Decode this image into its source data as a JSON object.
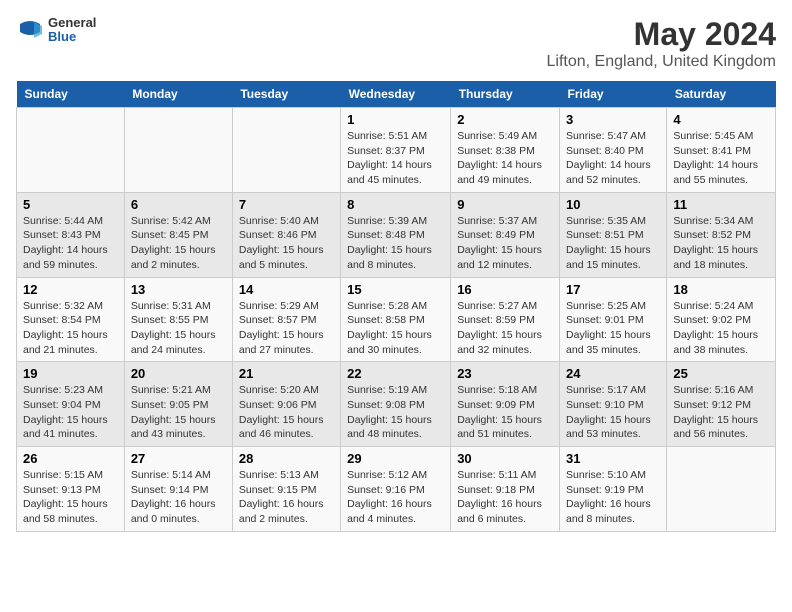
{
  "header": {
    "logo_general": "General",
    "logo_blue": "Blue",
    "title": "May 2024",
    "subtitle": "Lifton, England, United Kingdom"
  },
  "days_of_week": [
    "Sunday",
    "Monday",
    "Tuesday",
    "Wednesday",
    "Thursday",
    "Friday",
    "Saturday"
  ],
  "weeks": [
    [
      {
        "day": "",
        "info": ""
      },
      {
        "day": "",
        "info": ""
      },
      {
        "day": "",
        "info": ""
      },
      {
        "day": "1",
        "info": "Sunrise: 5:51 AM\nSunset: 8:37 PM\nDaylight: 14 hours\nand 45 minutes."
      },
      {
        "day": "2",
        "info": "Sunrise: 5:49 AM\nSunset: 8:38 PM\nDaylight: 14 hours\nand 49 minutes."
      },
      {
        "day": "3",
        "info": "Sunrise: 5:47 AM\nSunset: 8:40 PM\nDaylight: 14 hours\nand 52 minutes."
      },
      {
        "day": "4",
        "info": "Sunrise: 5:45 AM\nSunset: 8:41 PM\nDaylight: 14 hours\nand 55 minutes."
      }
    ],
    [
      {
        "day": "5",
        "info": "Sunrise: 5:44 AM\nSunset: 8:43 PM\nDaylight: 14 hours\nand 59 minutes."
      },
      {
        "day": "6",
        "info": "Sunrise: 5:42 AM\nSunset: 8:45 PM\nDaylight: 15 hours\nand 2 minutes."
      },
      {
        "day": "7",
        "info": "Sunrise: 5:40 AM\nSunset: 8:46 PM\nDaylight: 15 hours\nand 5 minutes."
      },
      {
        "day": "8",
        "info": "Sunrise: 5:39 AM\nSunset: 8:48 PM\nDaylight: 15 hours\nand 8 minutes."
      },
      {
        "day": "9",
        "info": "Sunrise: 5:37 AM\nSunset: 8:49 PM\nDaylight: 15 hours\nand 12 minutes."
      },
      {
        "day": "10",
        "info": "Sunrise: 5:35 AM\nSunset: 8:51 PM\nDaylight: 15 hours\nand 15 minutes."
      },
      {
        "day": "11",
        "info": "Sunrise: 5:34 AM\nSunset: 8:52 PM\nDaylight: 15 hours\nand 18 minutes."
      }
    ],
    [
      {
        "day": "12",
        "info": "Sunrise: 5:32 AM\nSunset: 8:54 PM\nDaylight: 15 hours\nand 21 minutes."
      },
      {
        "day": "13",
        "info": "Sunrise: 5:31 AM\nSunset: 8:55 PM\nDaylight: 15 hours\nand 24 minutes."
      },
      {
        "day": "14",
        "info": "Sunrise: 5:29 AM\nSunset: 8:57 PM\nDaylight: 15 hours\nand 27 minutes."
      },
      {
        "day": "15",
        "info": "Sunrise: 5:28 AM\nSunset: 8:58 PM\nDaylight: 15 hours\nand 30 minutes."
      },
      {
        "day": "16",
        "info": "Sunrise: 5:27 AM\nSunset: 8:59 PM\nDaylight: 15 hours\nand 32 minutes."
      },
      {
        "day": "17",
        "info": "Sunrise: 5:25 AM\nSunset: 9:01 PM\nDaylight: 15 hours\nand 35 minutes."
      },
      {
        "day": "18",
        "info": "Sunrise: 5:24 AM\nSunset: 9:02 PM\nDaylight: 15 hours\nand 38 minutes."
      }
    ],
    [
      {
        "day": "19",
        "info": "Sunrise: 5:23 AM\nSunset: 9:04 PM\nDaylight: 15 hours\nand 41 minutes."
      },
      {
        "day": "20",
        "info": "Sunrise: 5:21 AM\nSunset: 9:05 PM\nDaylight: 15 hours\nand 43 minutes."
      },
      {
        "day": "21",
        "info": "Sunrise: 5:20 AM\nSunset: 9:06 PM\nDaylight: 15 hours\nand 46 minutes."
      },
      {
        "day": "22",
        "info": "Sunrise: 5:19 AM\nSunset: 9:08 PM\nDaylight: 15 hours\nand 48 minutes."
      },
      {
        "day": "23",
        "info": "Sunrise: 5:18 AM\nSunset: 9:09 PM\nDaylight: 15 hours\nand 51 minutes."
      },
      {
        "day": "24",
        "info": "Sunrise: 5:17 AM\nSunset: 9:10 PM\nDaylight: 15 hours\nand 53 minutes."
      },
      {
        "day": "25",
        "info": "Sunrise: 5:16 AM\nSunset: 9:12 PM\nDaylight: 15 hours\nand 56 minutes."
      }
    ],
    [
      {
        "day": "26",
        "info": "Sunrise: 5:15 AM\nSunset: 9:13 PM\nDaylight: 15 hours\nand 58 minutes."
      },
      {
        "day": "27",
        "info": "Sunrise: 5:14 AM\nSunset: 9:14 PM\nDaylight: 16 hours\nand 0 minutes."
      },
      {
        "day": "28",
        "info": "Sunrise: 5:13 AM\nSunset: 9:15 PM\nDaylight: 16 hours\nand 2 minutes."
      },
      {
        "day": "29",
        "info": "Sunrise: 5:12 AM\nSunset: 9:16 PM\nDaylight: 16 hours\nand 4 minutes."
      },
      {
        "day": "30",
        "info": "Sunrise: 5:11 AM\nSunset: 9:18 PM\nDaylight: 16 hours\nand 6 minutes."
      },
      {
        "day": "31",
        "info": "Sunrise: 5:10 AM\nSunset: 9:19 PM\nDaylight: 16 hours\nand 8 minutes."
      },
      {
        "day": "",
        "info": ""
      }
    ]
  ]
}
